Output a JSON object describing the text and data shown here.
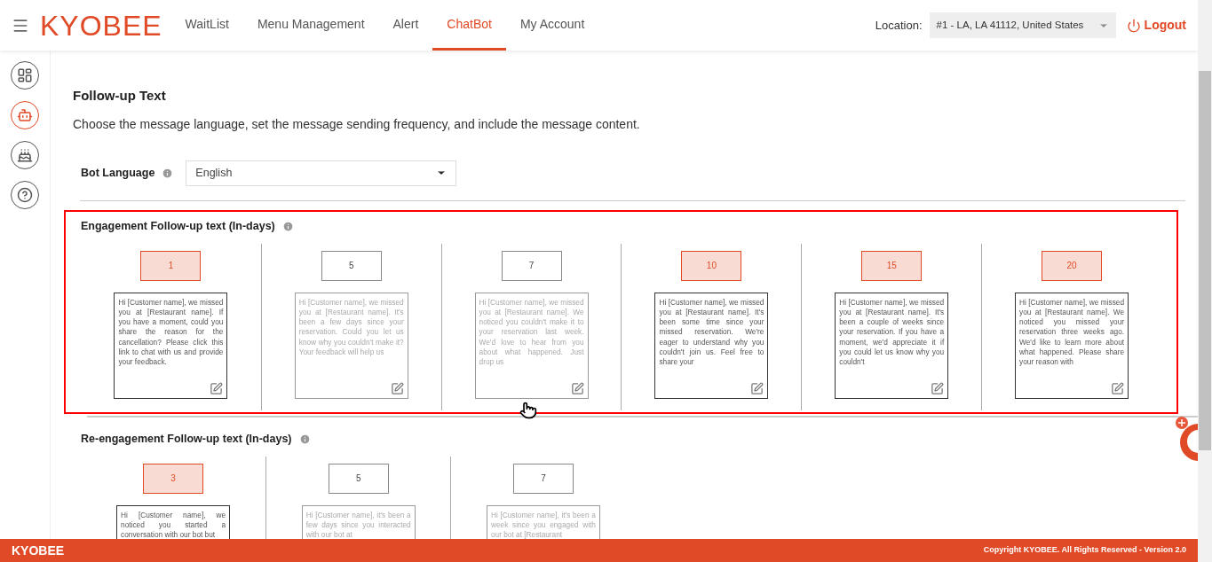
{
  "header": {
    "brand": "KYOBEE",
    "nav": [
      {
        "label": "WaitList",
        "selected": false
      },
      {
        "label": "Menu Management",
        "selected": false
      },
      {
        "label": "Alert",
        "selected": false
      },
      {
        "label": "ChatBot",
        "selected": true
      },
      {
        "label": "My Account",
        "selected": false
      }
    ],
    "location_label": "Location:",
    "location_value": "#1 - LA, LA 41112, United States",
    "logout": "Logout"
  },
  "sidebar": [
    {
      "kind": "dashboard",
      "selected": false
    },
    {
      "kind": "bot",
      "selected": true
    },
    {
      "kind": "cake",
      "selected": false
    },
    {
      "kind": "help",
      "selected": false
    }
  ],
  "title": "Follow-up Text",
  "description": "Choose the message language, set the message sending frequency, and include the message content.",
  "bot_language": {
    "label": "Bot Language",
    "value": "English"
  },
  "sections": [
    {
      "title": "Engagement Follow-up text (In-days)",
      "highlighted": true,
      "items": [
        {
          "day": "1",
          "selected": true,
          "message": "Hi [Customer name], we missed you at [Restaurant name]. If you have a moment, could you share the reason for the cancellation? Please click this link to chat with us and provide your feedback."
        },
        {
          "day": "5",
          "selected": false,
          "message": "Hi [Customer name], we missed you at [Restaurant name]. It's been a few days since your reservation. Could you let us know why you couldn't make it? Your feedback will help us"
        },
        {
          "day": "7",
          "selected": false,
          "message": "Hi [Customer name], we missed you at [Restaurant name]. We noticed you couldn't make it to your reservation last week. We'd love to hear from you about what happened. Just drop us"
        },
        {
          "day": "10",
          "selected": true,
          "message": "Hi [Customer name], we missed you at [Restaurant name]. It's been some time since your missed reservation. We're eager to understand why you couldn't join us. Feel free to share your"
        },
        {
          "day": "15",
          "selected": true,
          "message": "Hi [Customer name], we missed you at [Restaurant name]. It's been a couple of weeks since your reservation. If you have a moment, we'd appreciate it if you could let us know why you couldn't"
        },
        {
          "day": "20",
          "selected": true,
          "message": "Hi [Customer name], we missed you at [Restaurant name]. We noticed you missed your reservation three weeks ago. We'd like to learn more about what happened. Please share your reason with"
        }
      ]
    },
    {
      "title": "Re-engagement Follow-up text (In-days)",
      "highlighted": false,
      "items": [
        {
          "day": "3",
          "selected": true,
          "message": "Hi [Customer name], we noticed you started a conversation with our bot but"
        },
        {
          "day": "5",
          "selected": false,
          "message": "Hi [Customer name], it's been a few days since you interacted with our bot at"
        },
        {
          "day": "7",
          "selected": false,
          "message": "Hi [Customer name], it's been a week since you engaged with our bot at [Restaurant"
        }
      ]
    }
  ],
  "footer": {
    "brand": "KYOBEE",
    "copyright": "Copyright KYOBEE. All Rights Reserved - Version 2.0"
  }
}
